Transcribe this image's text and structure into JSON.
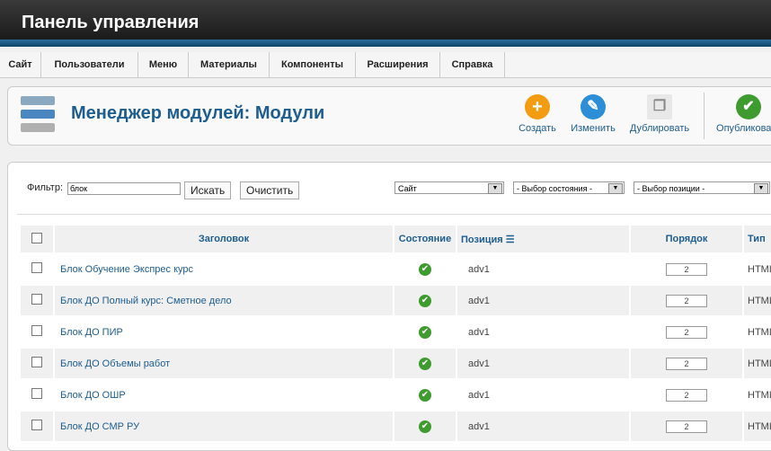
{
  "app": {
    "title": "Панель управления"
  },
  "menu": [
    "Сайт",
    "Пользователи",
    "Меню",
    "Материалы",
    "Компоненты",
    "Расширения",
    "Справка"
  ],
  "page": {
    "title": "Менеджер модулей: Модули"
  },
  "toolbar": {
    "create": "Создать",
    "edit": "Изменить",
    "duplicate": "Дублировать",
    "publish": "Опубликовать"
  },
  "filter": {
    "label": "Фильтр:",
    "value": "блок",
    "search_button": "Искать",
    "clear_button": "Очистить",
    "site_select": "Сайт",
    "state_select": "- Выбор состояния -",
    "position_select": "- Выбор позиции -"
  },
  "table": {
    "headers": {
      "title": "Заголовок",
      "state": "Состояние",
      "position": "Позиция",
      "order": "Порядок",
      "type": "Тип"
    },
    "rows": [
      {
        "title": "Блок Обучение Экспрес курс",
        "position": "adv1",
        "order": "2",
        "type": "HTML"
      },
      {
        "title": "Блок ДО Полный курс: Сметное дело",
        "position": "adv1",
        "order": "2",
        "type": "HTML"
      },
      {
        "title": "Блок ДО ПИР",
        "position": "adv1",
        "order": "2",
        "type": "HTML"
      },
      {
        "title": "Блок ДО Объемы работ",
        "position": "adv1",
        "order": "2",
        "type": "HTML"
      },
      {
        "title": "Блок ДО ОШР",
        "position": "adv1",
        "order": "2",
        "type": "HTML"
      },
      {
        "title": "Блок ДО СМР РУ",
        "position": "adv1",
        "order": "2",
        "type": "HTML"
      }
    ]
  },
  "colors": {
    "accent": "#1d5d8f",
    "published": "#3f9b2f",
    "create": "#f39c12",
    "edit": "#2c8ed6"
  }
}
